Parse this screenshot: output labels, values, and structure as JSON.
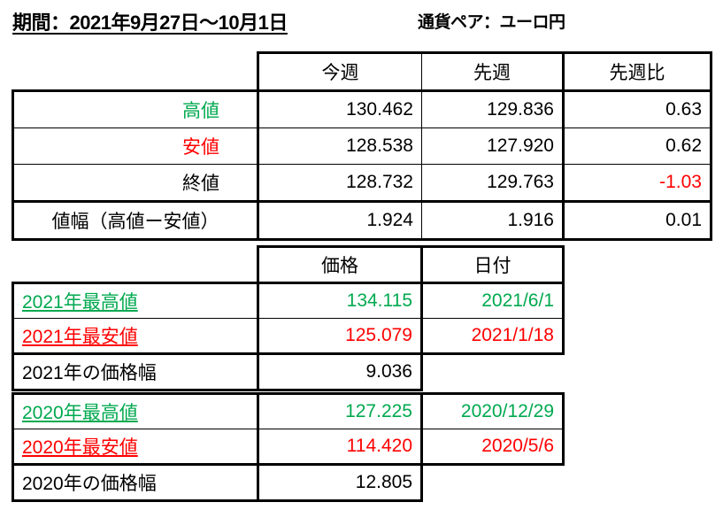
{
  "header": {
    "period_label": "期間：2021年9月27日〜10月1日",
    "pair_label": "通貨ペア：ユーロ円"
  },
  "colors": {
    "high_green": "#00a94f",
    "low_red": "#ff0000",
    "text": "#000000",
    "border": "#000000",
    "background": "#ffffff"
  },
  "weekly_table": {
    "columns": [
      "",
      "今週",
      "先週",
      "先週比"
    ],
    "rows": [
      {
        "label": "高値",
        "this_week": "130.462",
        "last_week": "129.836",
        "change": "0.63"
      },
      {
        "label": "安値",
        "this_week": "128.538",
        "last_week": "127.920",
        "change": "0.62"
      },
      {
        "label": "終値",
        "this_week": "128.732",
        "last_week": "129.763",
        "change": "-1.03"
      }
    ],
    "range_row": {
      "label": "値幅（高値ー安値）",
      "this_week": "1.924",
      "last_week": "1.916",
      "change": "0.01"
    }
  },
  "year_2021": {
    "columns": [
      "",
      "価格",
      "日付"
    ],
    "rows": [
      {
        "label": "2021年最高値",
        "price": "134.115",
        "date": "2021/6/1"
      },
      {
        "label": "2021年最安値",
        "price": "125.079",
        "date": "2021/1/18"
      }
    ],
    "range_row": {
      "label": "2021年の価格幅",
      "price": "9.036",
      "date": ""
    }
  },
  "year_2020": {
    "rows": [
      {
        "label": "2020年最高値",
        "price": "127.225",
        "date": "2020/12/29"
      },
      {
        "label": "2020年最安値",
        "price": "114.420",
        "date": "2020/5/6"
      }
    ],
    "range_row": {
      "label": "2020年の価格幅",
      "price": "12.805",
      "date": ""
    }
  }
}
